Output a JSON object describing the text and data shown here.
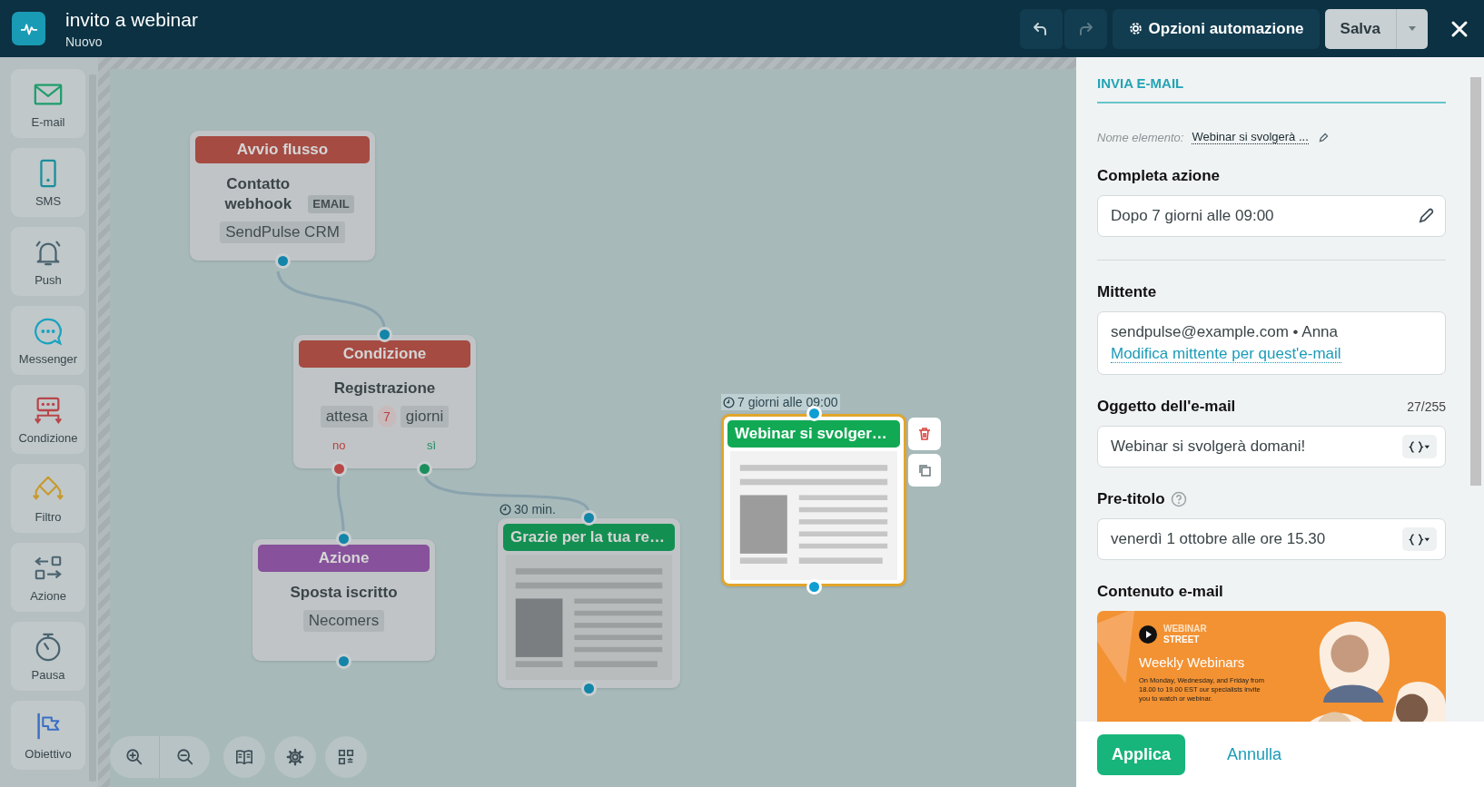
{
  "window": {
    "title": "invito a webinar",
    "subtitle": "Nuovo"
  },
  "toolbar": {
    "options": "Opzioni automazione",
    "save": "Salva"
  },
  "sidebar": {
    "items": [
      {
        "kind": "email",
        "label": "E-mail"
      },
      {
        "kind": "sms",
        "label": "SMS"
      },
      {
        "kind": "push",
        "label": "Push"
      },
      {
        "kind": "messenger",
        "label": "Messenger"
      },
      {
        "kind": "condition",
        "label": "Condizione"
      },
      {
        "kind": "filter",
        "label": "Filtro"
      },
      {
        "kind": "action",
        "label": "Azione"
      },
      {
        "kind": "pause",
        "label": "Pausa"
      },
      {
        "kind": "goal",
        "label": "Obiettivo"
      }
    ]
  },
  "canvas": {
    "nodes": [
      {
        "kind": "start",
        "header": "Avvio flusso",
        "color": "#a54b42",
        "title": "Contatto webhook",
        "badge": "EMAIL",
        "tag": "SendPulse CRM"
      },
      {
        "kind": "condition",
        "header": "Condizione",
        "color": "#a54b42",
        "title": "Registrazione",
        "chips": [
          {
            "kind": "word",
            "text": "attesa"
          },
          {
            "kind": "number",
            "text": "7"
          },
          {
            "kind": "word",
            "text": "giorni"
          }
        ],
        "outputs": [
          {
            "kind": "no",
            "label": "no"
          },
          {
            "kind": "yes",
            "label": "sì"
          }
        ]
      },
      {
        "kind": "action",
        "header": "Azione",
        "color": "#87529b",
        "title": "Sposta iscritto",
        "tag": "Necomers"
      },
      {
        "kind": "email",
        "header": "Grazie per la tua re…",
        "color": "#148f52",
        "delay": "30 min.",
        "selected": false
      },
      {
        "kind": "email",
        "header": "Webinar si svolger…",
        "color": "#12a955",
        "delay": "7 giorni alle 09:00",
        "selected": true
      }
    ]
  },
  "panel": {
    "title": "INVIA E-MAIL",
    "element_name": {
      "label": "Nome elemento:",
      "value": "Webinar si svolgerà ..."
    },
    "schedule": {
      "label": "Completa azione",
      "value": "Dopo 7 giorni alle 09:00"
    },
    "sender": {
      "label": "Mittente",
      "value": "sendpulse@example.com • Anna",
      "link": "Modifica mittente per quest'e-mail"
    },
    "subject": {
      "label": "Oggetto dell'e-mail",
      "counter": "27/255",
      "value": "Webinar si svolgerà domani!"
    },
    "preheader": {
      "label": "Pre-titolo",
      "value": "venerdì 1 ottobre alle ore 15.30"
    },
    "content": {
      "label": "Contenuto e-mail",
      "preview": {
        "brand_top": "WEBINAR",
        "brand_bottom": "STREET",
        "heading": "Weekly Webinars",
        "text": "On Monday, Wednesday, and Friday from 18.00 to 19.00 EST our specialists invite you to watch or webinar."
      }
    }
  },
  "footer": {
    "apply": "Applica",
    "cancel": "Annulla"
  }
}
